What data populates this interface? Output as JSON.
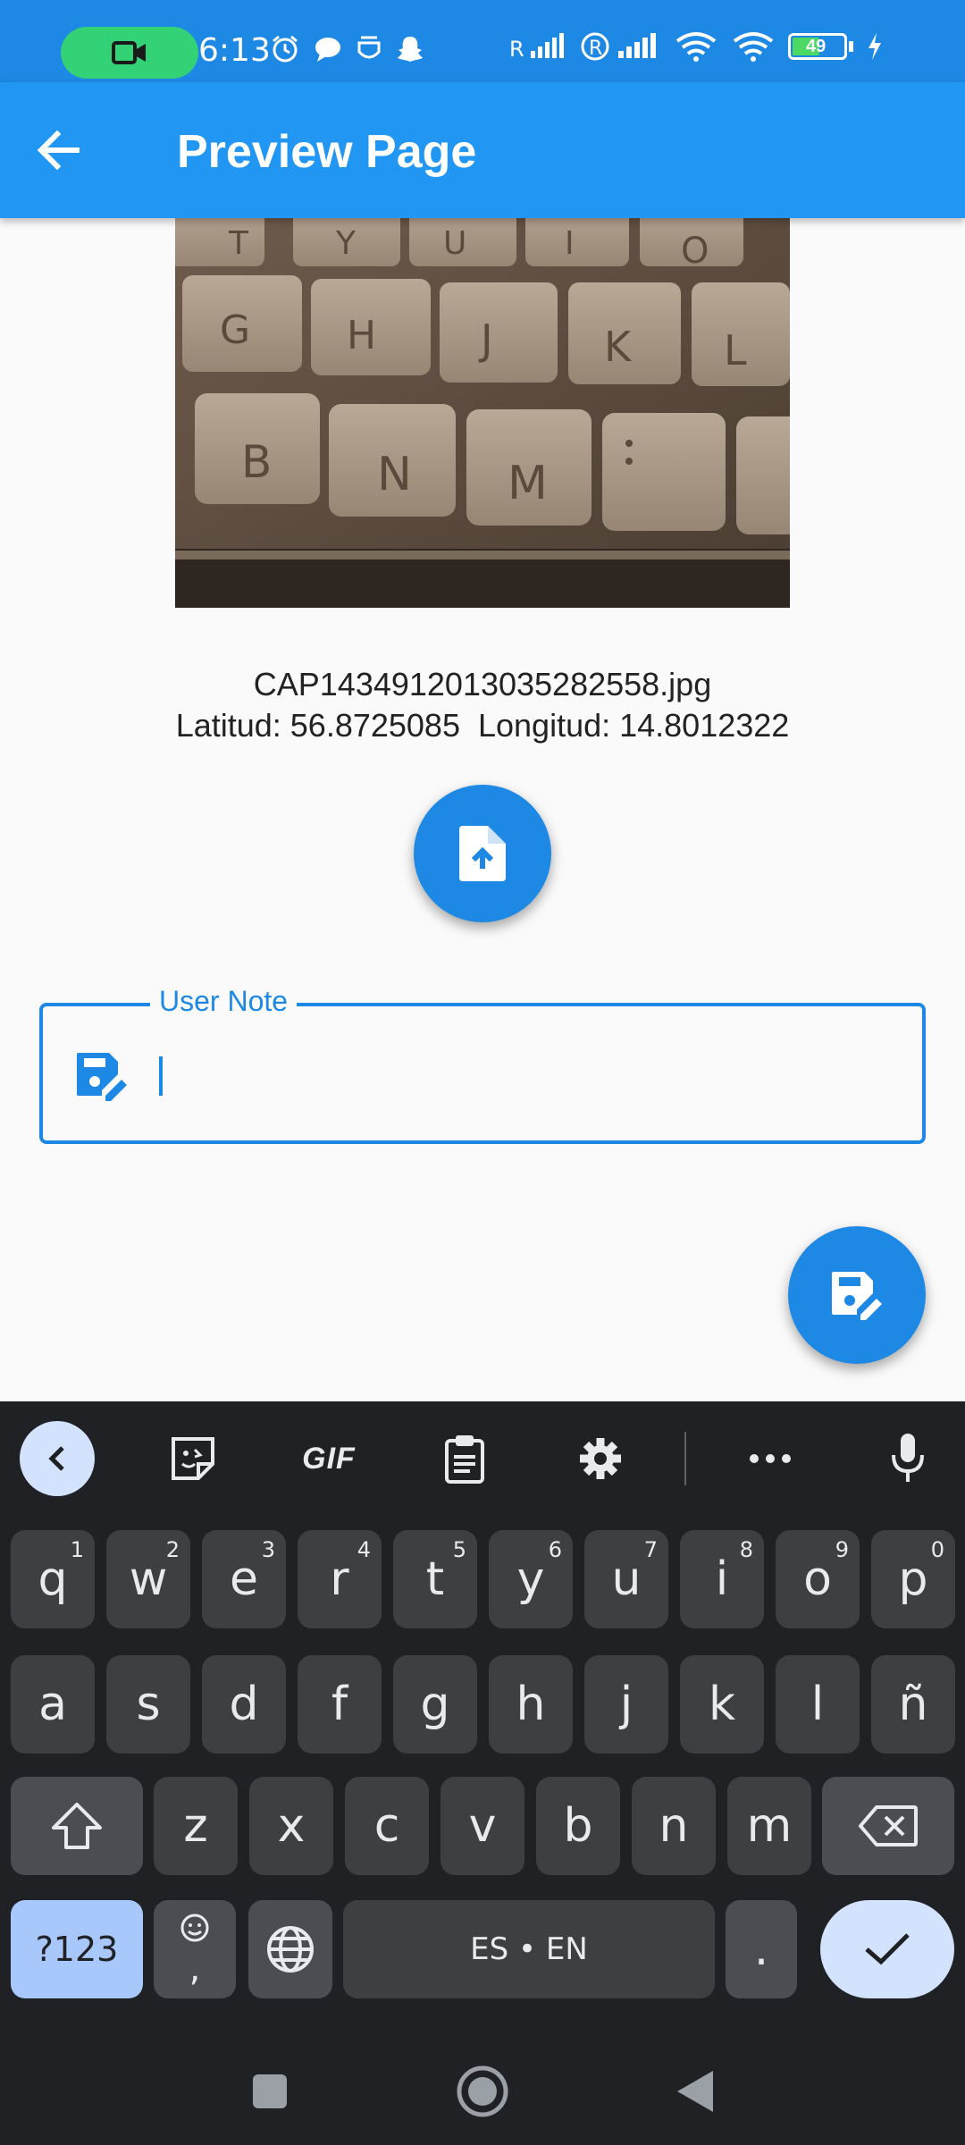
{
  "status_bar": {
    "time": "6:13",
    "battery": "49"
  },
  "app_bar": {
    "title": "Preview Page"
  },
  "preview": {
    "key_letters": [
      "T",
      "Y",
      "U",
      "I",
      "O",
      "G",
      "H",
      "J",
      "K",
      "L",
      "B",
      "N",
      "M"
    ]
  },
  "photo_info": {
    "filename": "CAP1434912013035282558.jpg",
    "latitude": "Latitud: 56.8725085",
    "longitude": "Longitud: 14.8012322"
  },
  "note_field": {
    "label": "User Note",
    "value": ""
  },
  "keyboard": {
    "toolbar": {
      "gif": "GIF"
    },
    "row1": [
      {
        "k": "q",
        "h": "1"
      },
      {
        "k": "w",
        "h": "2"
      },
      {
        "k": "e",
        "h": "3"
      },
      {
        "k": "r",
        "h": "4"
      },
      {
        "k": "t",
        "h": "5"
      },
      {
        "k": "y",
        "h": "6"
      },
      {
        "k": "u",
        "h": "7"
      },
      {
        "k": "i",
        "h": "8"
      },
      {
        "k": "o",
        "h": "9"
      },
      {
        "k": "p",
        "h": "0"
      }
    ],
    "row2": [
      "a",
      "s",
      "d",
      "f",
      "g",
      "h",
      "j",
      "k",
      "l",
      "ñ"
    ],
    "row3": [
      "z",
      "x",
      "c",
      "v",
      "b",
      "n",
      "m"
    ],
    "symbols_label": "?123",
    "comma_label": ",",
    "space_label": "ES • EN",
    "period_label": "."
  },
  "colors": {
    "primary": "#2196f3",
    "primary_dark": "#1e88e5",
    "keyboard_bg": "#202124",
    "key_bg": "#3c4043"
  }
}
